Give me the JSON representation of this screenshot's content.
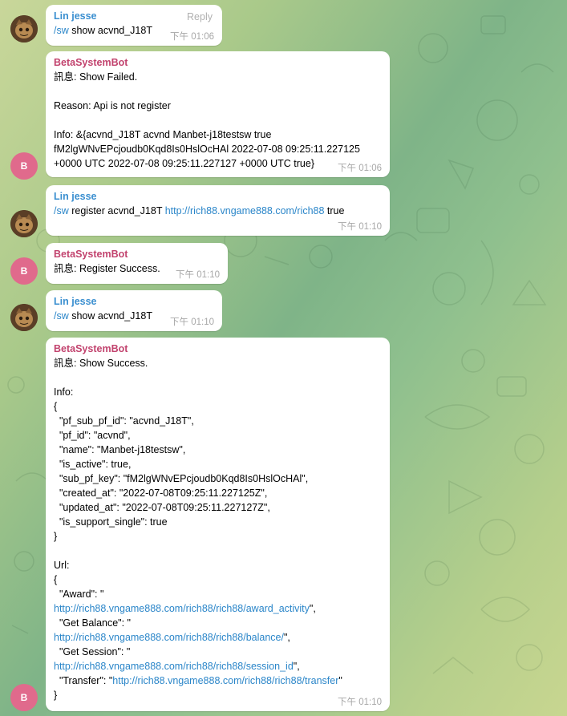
{
  "messages": [
    {
      "sender": "Lin jesse",
      "command": "/sw",
      "text": " show acvnd_J18T",
      "time": "下午 01:06",
      "reply_label": "Reply"
    },
    {
      "sender": "BetaSystemBot",
      "avatar_letter": "B",
      "lines": [
        "訊息: Show Failed.",
        "",
        "Reason: Api is not register",
        "",
        "Info: &{acvnd_J18T acvnd Manbet-j18testsw true",
        "fM2lgWNvEPcjoudb0Kqd8Is0HslOcHAl 2022-07-08 09:25:11.227125",
        "+0000 UTC 2022-07-08 09:25:11.227127 +0000 UTC true}"
      ],
      "time": "下午 01:06"
    },
    {
      "sender": "Lin jesse",
      "command": "/sw",
      "text_before_link": " register acvnd_J18T ",
      "link": "http://rich88.vngame888.com/rich88",
      "text_after_link": " true",
      "time": "下午 01:10"
    },
    {
      "sender": "BetaSystemBot",
      "avatar_letter": "B",
      "text": "訊息: Register Success.",
      "time": "下午 01:10"
    },
    {
      "sender": "Lin jesse",
      "command": "/sw",
      "text": " show acvnd_J18T",
      "time": "下午 01:10"
    },
    {
      "sender": "BetaSystemBot",
      "avatar_letter": "B",
      "lines_top": [
        "訊息: Show Success.",
        "",
        "Info:",
        "{",
        "  \"pf_sub_pf_id\": \"acvnd_J18T\",",
        "  \"pf_id\": \"acvnd\",",
        "  \"name\": \"Manbet-j18testsw\",",
        "  \"is_active\": true,",
        "  \"sub_pf_key\": \"fM2lgWNvEPcjoudb0Kqd8Is0HslOcHAl\",",
        "  \"created_at\": \"2022-07-08T09:25:11.227125Z\",",
        "  \"updated_at\": \"2022-07-08T09:25:11.227127Z\",",
        "  \"is_support_single\": true",
        "}",
        "",
        "Url:",
        "{"
      ],
      "url_award_key": "  \"Award\": \"",
      "url_award": "http://rich88.vngame888.com/rich88/rich88/award_activity",
      "url_award_end": "\",",
      "url_balance_key": "  \"Get Balance\": \"",
      "url_balance": "http://rich88.vngame888.com/rich88/rich88/balance/",
      "url_balance_end": "\",",
      "url_session_key": "  \"Get Session\": \"",
      "url_session": "http://rich88.vngame888.com/rich88/rich88/session_id",
      "url_session_end": "\",",
      "url_transfer_key": "  \"Transfer\": \"",
      "url_transfer": "http://rich88.vngame888.com/rich88/rich88/transfer",
      "url_transfer_end": "\"",
      "closing": "}",
      "time": "下午 01:10"
    }
  ],
  "colors": {
    "user_name": "#3a8fd0",
    "bot_name": "#c2436e",
    "link": "#2b86c9",
    "bot_avatar": "#e06a8c",
    "time": "#a7a7a7"
  }
}
